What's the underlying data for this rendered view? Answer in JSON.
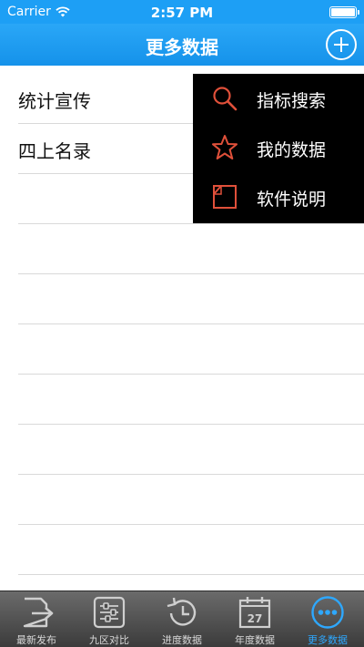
{
  "status_bar": {
    "carrier": "Carrier",
    "time": "2:57 PM"
  },
  "nav": {
    "title": "更多数据"
  },
  "list": {
    "items": [
      "统计宣传",
      "四上名录",
      "",
      "",
      "",
      "",
      "",
      "",
      "",
      ""
    ]
  },
  "popup": {
    "items": [
      {
        "label": "指标搜索",
        "icon": "search-icon"
      },
      {
        "label": "我的数据",
        "icon": "star-icon"
      },
      {
        "label": "软件说明",
        "icon": "document-icon"
      }
    ]
  },
  "tabs": [
    {
      "label": "最新发布",
      "icon": "publish-export-icon"
    },
    {
      "label": "九区对比",
      "icon": "sliders-icon"
    },
    {
      "label": "进度数据",
      "icon": "history-clock-icon"
    },
    {
      "label": "年度数据",
      "icon": "calendar-icon",
      "calendar_day": "27"
    },
    {
      "label": "更多数据",
      "icon": "more-dots-icon",
      "active": true
    }
  ],
  "colors": {
    "accent": "#1d9ff5",
    "menu_icon": "#e0503a",
    "tab_active": "#2ea8ff"
  }
}
